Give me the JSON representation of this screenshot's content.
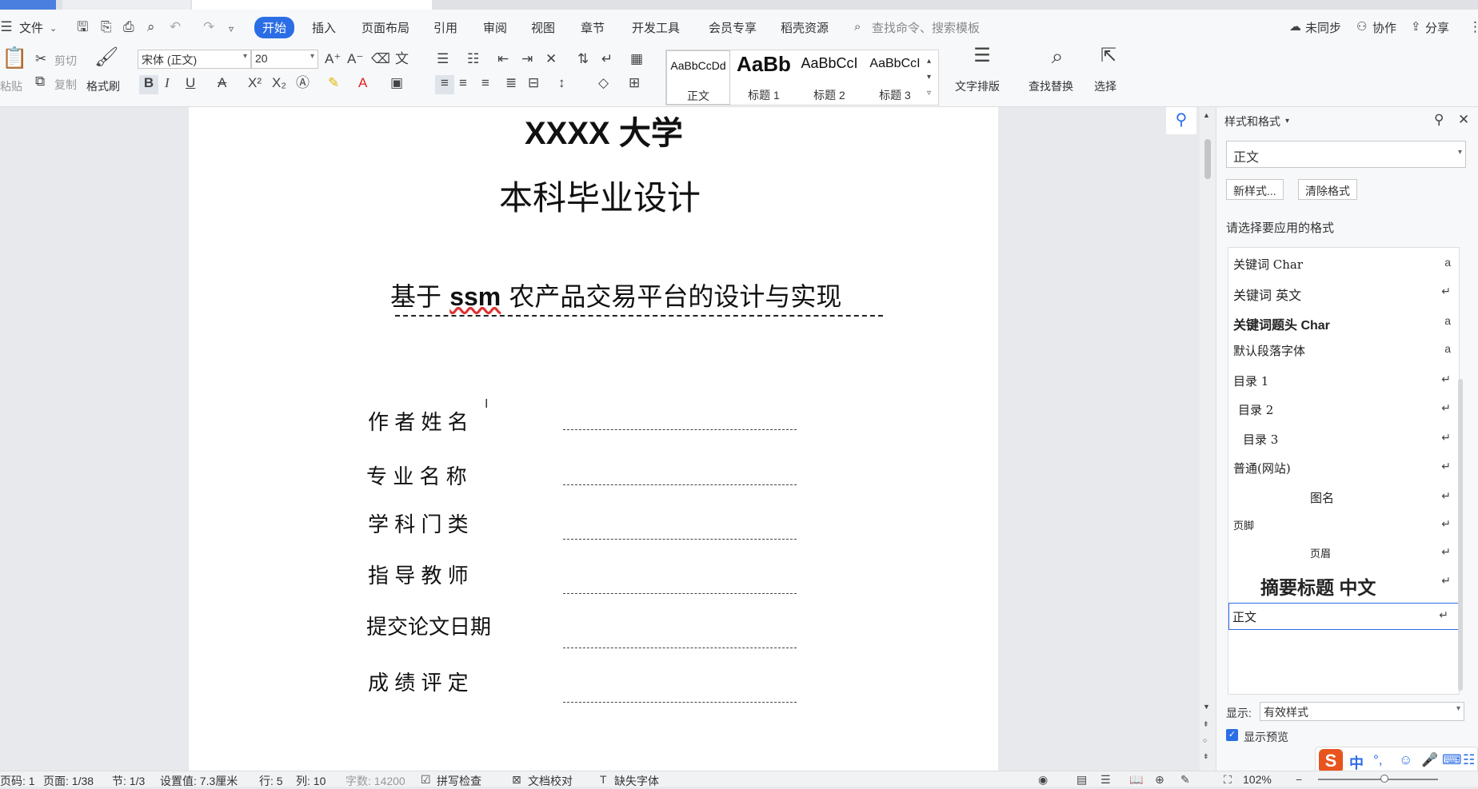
{
  "menubar": {
    "file_label": "文件",
    "tabs": [
      "开始",
      "插入",
      "页面布局",
      "引用",
      "审阅",
      "视图",
      "章节",
      "开发工具",
      "会员专享",
      "稻壳资源"
    ],
    "search_placeholder": "查找命令、搜索模板",
    "sync_label": "未同步",
    "collab_label": "协作",
    "share_label": "分享"
  },
  "ribbon": {
    "paste_label": "粘贴",
    "cut_label": "剪切",
    "copy_label": "复制",
    "format_painter_label": "格式刷",
    "font_name": "宋体 (正文)",
    "font_size": "20",
    "styles": [
      {
        "sample": "AaBbCcDd",
        "name": "正文"
      },
      {
        "sample": "AaBb",
        "name": "标题 1"
      },
      {
        "sample": "AaBbCcI",
        "name": "标题 2"
      },
      {
        "sample": "AaBbCcI",
        "name": "标题 3"
      }
    ],
    "text_layout_label": "文字排版",
    "find_replace_label": "查找替换",
    "select_label": "选择"
  },
  "document": {
    "university": "XXXX 大学",
    "subtitle": "本科毕业设计",
    "title_prefix": "基于 ",
    "title_ssm": "ssm",
    "title_suffix": " 农产品交易平台的设计与实现",
    "fields": [
      "作 者 姓 名",
      "专 业 名 称",
      "学 科 门 类",
      "指 导 教 师",
      "提交论文日期",
      "成 绩 评 定"
    ]
  },
  "panel": {
    "title": "样式和格式",
    "current_style": "正文",
    "new_style_label": "新样式...",
    "clear_format_label": "清除格式",
    "choose_label": "请选择要应用的格式",
    "styles": [
      {
        "name": "关键词 Char",
        "mark": "a"
      },
      {
        "name": "关键词 英文",
        "mark": "↵"
      },
      {
        "name": "关键词题头 Char",
        "mark": "a"
      },
      {
        "name": "默认段落字体",
        "mark": "a"
      },
      {
        "name": "目录 1",
        "mark": "↵"
      },
      {
        "name": "目录 2",
        "mark": "↵"
      },
      {
        "name": "目录 3",
        "mark": "↵"
      },
      {
        "name": "普通(网站)",
        "mark": "↵"
      },
      {
        "name": "图名",
        "mark": "↵"
      },
      {
        "name": "页脚",
        "mark": "↵"
      },
      {
        "name": "页眉",
        "mark": "↵"
      },
      {
        "name": "摘要标题 中文",
        "mark": "↵"
      },
      {
        "name": "正文",
        "mark": "↵"
      }
    ],
    "show_label": "显示:",
    "show_value": "有效样式",
    "preview_label": "显示预览",
    "preview_checked": true
  },
  "status": {
    "page_code": "页码: 1",
    "pages": "页面: 1/38",
    "section": "节: 1/3",
    "setting": "设置值: 7.3厘米",
    "row": "行: 5",
    "col": "列: 10",
    "word_count": "字数: 14200",
    "spell_check": "拼写检查",
    "doc_check": "文档校对",
    "missing_font": "缺失字体",
    "zoom": "102%"
  },
  "ime": {
    "lang": "中"
  },
  "colors": {
    "accent": "#2b6de5",
    "ime_brand": "#e8541e"
  }
}
